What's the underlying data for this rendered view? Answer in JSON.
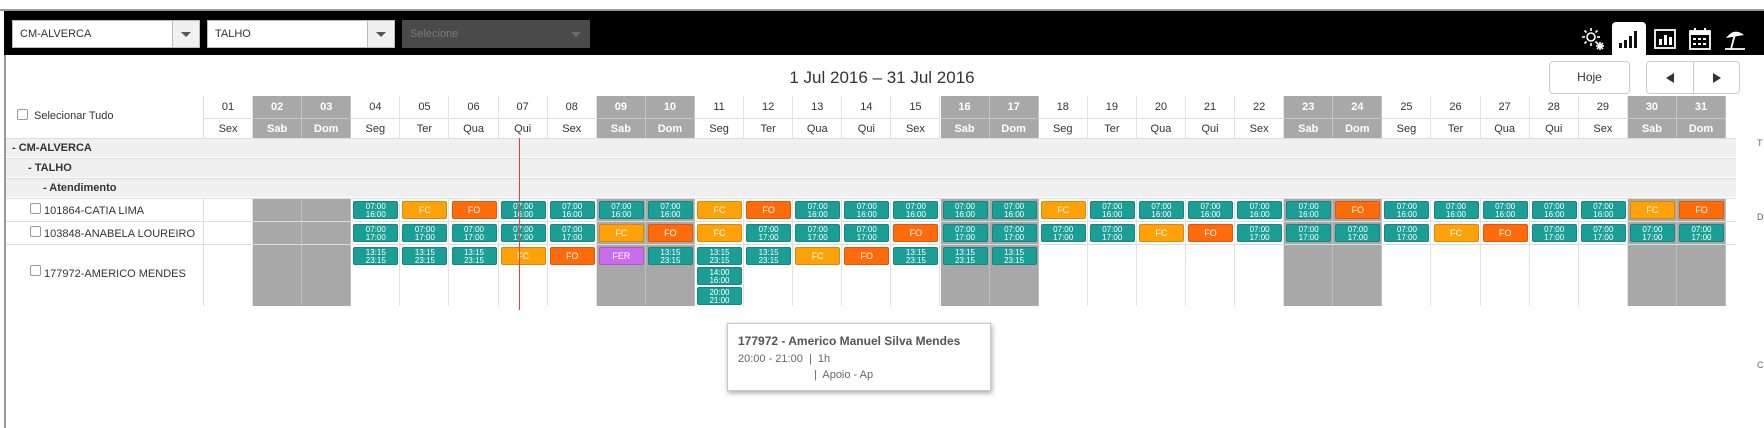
{
  "toolbar": {
    "select1": "CM-ALVERCA",
    "select2": "TALHO",
    "select3_placeholder": "Selecione",
    "icons": [
      "weather-sun-snow-icon",
      "bar-chart-icon",
      "report-chart-icon",
      "calendar-icon",
      "beach-umbrella-icon"
    ],
    "active_icon": "bar-chart-icon"
  },
  "header": {
    "range_title": "1 Jul 2016 – 31 Jul 2016",
    "today_label": "Hoje",
    "prev_icon": "prev-arrow-icon",
    "next_icon": "next-arrow-icon"
  },
  "grid": {
    "select_all_label": "Selecionar Tudo",
    "days": [
      {
        "n": "01",
        "d": "Sex",
        "we": false
      },
      {
        "n": "02",
        "d": "Sab",
        "we": true
      },
      {
        "n": "03",
        "d": "Dom",
        "we": true
      },
      {
        "n": "04",
        "d": "Seg",
        "we": false
      },
      {
        "n": "05",
        "d": "Ter",
        "we": false
      },
      {
        "n": "06",
        "d": "Qua",
        "we": false
      },
      {
        "n": "07",
        "d": "Qui",
        "we": false
      },
      {
        "n": "08",
        "d": "Sex",
        "we": false
      },
      {
        "n": "09",
        "d": "Sab",
        "we": true
      },
      {
        "n": "10",
        "d": "Dom",
        "we": true
      },
      {
        "n": "11",
        "d": "Seg",
        "we": false
      },
      {
        "n": "12",
        "d": "Ter",
        "we": false
      },
      {
        "n": "13",
        "d": "Qua",
        "we": false
      },
      {
        "n": "14",
        "d": "Qui",
        "we": false
      },
      {
        "n": "15",
        "d": "Sex",
        "we": false
      },
      {
        "n": "16",
        "d": "Sab",
        "we": true
      },
      {
        "n": "17",
        "d": "Dom",
        "we": true
      },
      {
        "n": "18",
        "d": "Seg",
        "we": false
      },
      {
        "n": "19",
        "d": "Ter",
        "we": false
      },
      {
        "n": "20",
        "d": "Qua",
        "we": false
      },
      {
        "n": "21",
        "d": "Qui",
        "we": false
      },
      {
        "n": "22",
        "d": "Sex",
        "we": false
      },
      {
        "n": "23",
        "d": "Sab",
        "we": true
      },
      {
        "n": "24",
        "d": "Dom",
        "we": true
      },
      {
        "n": "25",
        "d": "Seg",
        "we": false
      },
      {
        "n": "26",
        "d": "Ter",
        "we": false
      },
      {
        "n": "27",
        "d": "Qua",
        "we": false
      },
      {
        "n": "28",
        "d": "Qui",
        "we": false
      },
      {
        "n": "29",
        "d": "Sex",
        "we": false
      },
      {
        "n": "30",
        "d": "Sab",
        "we": true
      },
      {
        "n": "31",
        "d": "Dom",
        "we": true
      }
    ],
    "groups": {
      "store": "- CM-ALVERCA",
      "dept": "- TALHO",
      "section": "- Atendimento"
    },
    "employees": [
      {
        "name": "101864-CATIA LIMA",
        "shifts": [
          null,
          null,
          null,
          [
            "07:00",
            "16:00"
          ],
          "FC",
          "FO",
          [
            "07:00",
            "16:00"
          ],
          [
            "07:00",
            "16:00"
          ],
          [
            "07:00",
            "16:00"
          ],
          [
            "07:00",
            "16:00"
          ],
          "FC",
          "FO",
          [
            "07:00",
            "16:00"
          ],
          [
            "07:00",
            "16:00"
          ],
          [
            "07:00",
            "16:00"
          ],
          [
            "07:00",
            "16:00"
          ],
          [
            "07:00",
            "16:00"
          ],
          "FC",
          [
            "07:00",
            "16:00"
          ],
          [
            "07:00",
            "16:00"
          ],
          [
            "07:00",
            "16:00"
          ],
          [
            "07:00",
            "16:00"
          ],
          [
            "07:00",
            "16:00"
          ],
          "FO",
          [
            "07:00",
            "16:00"
          ],
          [
            "07:00",
            "16:00"
          ],
          [
            "07:00",
            "16:00"
          ],
          [
            "07:00",
            "16:00"
          ],
          [
            "07:00",
            "16:00"
          ],
          "FC",
          "FO"
        ]
      },
      {
        "name": "103848-ANABELA LOUREIRO",
        "shifts": [
          null,
          null,
          null,
          [
            "07:00",
            "17:00"
          ],
          [
            "07:00",
            "17:00"
          ],
          [
            "07:00",
            "17:00"
          ],
          [
            "07:00",
            "17:00"
          ],
          [
            "07:00",
            "17:00"
          ],
          "FC",
          "FO",
          "FC",
          [
            "07:00",
            "17:00"
          ],
          [
            "07:00",
            "17:00"
          ],
          [
            "07:00",
            "17:00"
          ],
          "FO",
          [
            "07:00",
            "17:00"
          ],
          [
            "07:00",
            "17:00"
          ],
          [
            "07:00",
            "17:00"
          ],
          [
            "07:00",
            "17:00"
          ],
          "FC",
          "FO",
          [
            "07:00",
            "17:00"
          ],
          [
            "07:00",
            "17:00"
          ],
          [
            "07:00",
            "17:00"
          ],
          [
            "07:00",
            "17:00"
          ],
          "FC",
          "FO",
          [
            "07:00",
            "17:00"
          ],
          [
            "07:00",
            "17:00"
          ],
          [
            "07:00",
            "17:00"
          ],
          [
            "07:00",
            "17:00"
          ]
        ]
      },
      {
        "name": "177972-AMERICO MENDES",
        "shifts": [
          null,
          null,
          null,
          [
            "13:15",
            "23:15"
          ],
          [
            "13:15",
            "23:15"
          ],
          [
            "13:15",
            "23:15"
          ],
          "FC",
          "FO",
          "FER",
          [
            "13:15",
            "23:15"
          ],
          [
            [
              "13:15",
              "23:15"
            ],
            [
              "14:00",
              "16:00"
            ],
            [
              "20:00",
              "21:00"
            ]
          ],
          [
            "13:15",
            "23:15"
          ],
          "FC",
          "FO",
          [
            "13:15",
            "23:15"
          ],
          [
            "13:15",
            "23:15"
          ],
          [
            "13:15",
            "23:15"
          ],
          null,
          null,
          null,
          null,
          null,
          null,
          null,
          null,
          null,
          null,
          null,
          null,
          null,
          null
        ]
      }
    ]
  },
  "tooltip": {
    "title": "177972 - Americo Manuel Silva Mendes",
    "line1": "20:00 - 21:00  |  1h",
    "line2": "|  Apoio - Ap"
  },
  "right_edge_glyphs": [
    "T",
    "D",
    "C"
  ]
}
